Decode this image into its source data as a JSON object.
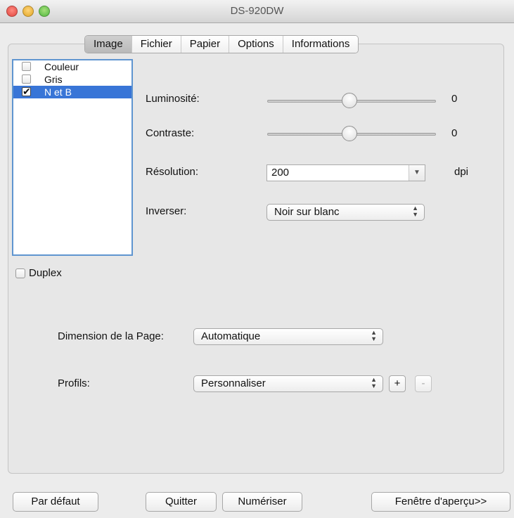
{
  "window": {
    "title": "DS-920DW"
  },
  "tabs": [
    {
      "label": "Image",
      "active": true
    },
    {
      "label": "Fichier",
      "active": false
    },
    {
      "label": "Papier",
      "active": false
    },
    {
      "label": "Options",
      "active": false
    },
    {
      "label": "Informations",
      "active": false
    }
  ],
  "color_modes": [
    {
      "label": "Couleur",
      "checked": false,
      "selected": false
    },
    {
      "label": "Gris",
      "checked": false,
      "selected": false
    },
    {
      "label": "N et B",
      "checked": true,
      "selected": true
    }
  ],
  "duplex": {
    "label": "Duplex",
    "checked": false
  },
  "settings": {
    "brightness": {
      "label": "Luminosité:",
      "value": "0",
      "slider_fraction": 0.5
    },
    "contrast": {
      "label": "Contraste:",
      "value": "0",
      "slider_fraction": 0.5
    },
    "resolution": {
      "label": "Résolution:",
      "value": "200",
      "unit": "dpi"
    },
    "invert": {
      "label": "Inverser:",
      "value": "Noir sur blanc"
    }
  },
  "page": {
    "dimension_label": "Dimension de la Page:",
    "dimension_value": "Automatique",
    "profiles_label": "Profils:",
    "profiles_value": "Personnaliser",
    "add_label": "+",
    "remove_label": "-"
  },
  "buttons": {
    "defaults": "Par défaut",
    "quit": "Quitter",
    "scan": "Numériser",
    "preview": "Fenêtre d'aperçu>>"
  },
  "colors": {
    "selection": "#3875d7",
    "list_border": "#5f95d0"
  }
}
